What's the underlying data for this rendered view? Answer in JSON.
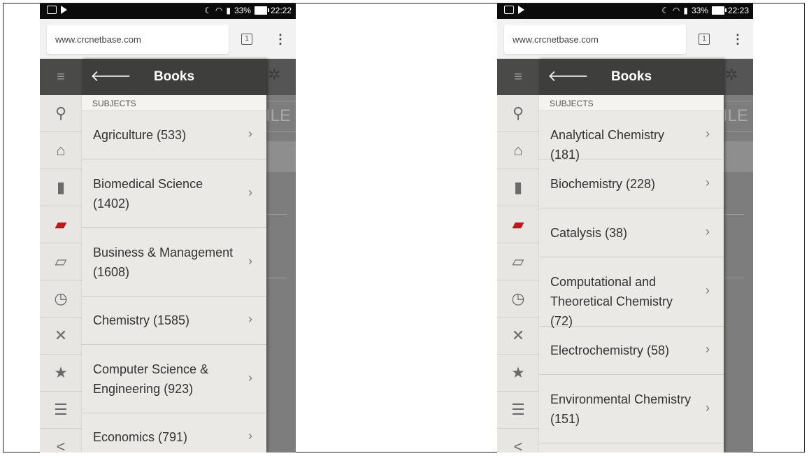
{
  "left": {
    "status": {
      "signal": "33%",
      "time": "22:22"
    },
    "url": "www.crcnetbase.com",
    "tab_count": "1",
    "bg_label": "ILE",
    "drawer_title": "Books",
    "section": "SUBJECTS",
    "items": [
      {
        "label": "Agriculture (533)",
        "height": 68
      },
      {
        "label": "Biomedical Science (1402)",
        "height": 97
      },
      {
        "label": "Business & Management (1608)",
        "height": 97
      },
      {
        "label": "Chemistry (1585)",
        "height": 68
      },
      {
        "label": "Computer Science & Engineering (923)",
        "height": 97
      },
      {
        "label": "Economics (791)",
        "height": 68
      }
    ]
  },
  "right": {
    "status": {
      "signal": "33%",
      "time": "22:23"
    },
    "url": "www.crcnetbase.com",
    "tab_count": "1",
    "bg_label": "ILE",
    "drawer_title": "Books",
    "section": "SUBJECTS",
    "items": [
      {
        "label": "Analytical Chemistry (181)",
        "height": 68
      },
      {
        "label": "Biochemistry (228)",
        "height": 69
      },
      {
        "label": "Catalysis (38)",
        "height": 69
      },
      {
        "label": "Computational and Theoretical Chemistry (72)",
        "height": 98
      },
      {
        "label": "Electrochemistry (58)",
        "height": 68
      },
      {
        "label": "Environmental Chemistry (151)",
        "height": 97
      }
    ]
  },
  "rail_icons": [
    "menu-icon",
    "search-icon",
    "home-icon",
    "book-icon",
    "open-book-icon",
    "reading-list-icon",
    "timer-icon",
    "ribbon-icon",
    "star-icon",
    "profile-icon",
    "share-icon"
  ],
  "accent_color": "#c0161c"
}
